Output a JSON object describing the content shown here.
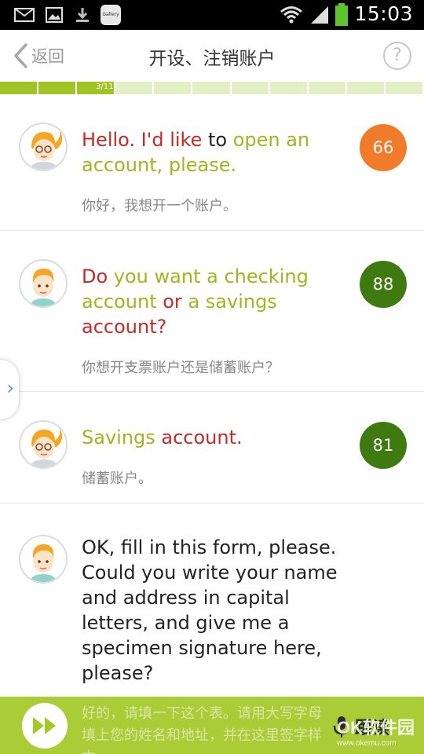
{
  "status_bar": {
    "time": "15:03",
    "icons": [
      "mail-icon",
      "image-icon",
      "download-icon",
      "gallery-app-icon",
      "wifi-icon",
      "signal-icon",
      "battery-icon"
    ],
    "gallery_label": "Gallery"
  },
  "header": {
    "back_label": "返回",
    "title": "开设、注销账户",
    "help_label": "?"
  },
  "progress": {
    "label": "3/11",
    "current": 3,
    "total": 11
  },
  "dialog": [
    {
      "speaker": "woman",
      "words": [
        {
          "t": "Hello. I'd ",
          "c": "red"
        },
        {
          "t": "like ",
          "c": "red"
        },
        {
          "t": "to ",
          "c": "black"
        },
        {
          "t": "open an account, please.",
          "c": "green"
        }
      ],
      "translation": "你好，我想开一个账户。",
      "score": "66",
      "score_color": "#f07b2b"
    },
    {
      "speaker": "man",
      "words": [
        {
          "t": "Do ",
          "c": "red"
        },
        {
          "t": "you want a checking account ",
          "c": "green"
        },
        {
          "t": "or ",
          "c": "red"
        },
        {
          "t": "a savings ",
          "c": "green"
        },
        {
          "t": "account?",
          "c": "red"
        }
      ],
      "translation": "你想开支票账户还是储蓄账户？",
      "score": "88",
      "score_color": "#3f7a10"
    },
    {
      "speaker": "woman",
      "words": [
        {
          "t": "Savings ",
          "c": "green"
        },
        {
          "t": "account.",
          "c": "red"
        }
      ],
      "translation": "储蓄账户。",
      "score": "81",
      "score_color": "#3f7a10"
    },
    {
      "speaker": "man",
      "words": [
        {
          "t": "OK, fill in this form, please. Could you write your name and address in capital letters, and give me a specimen signature here, please?",
          "c": "dark"
        }
      ],
      "translation": "好的，请填一下这个表。请用大写字母填上您的姓名和地址，并在这里签字样本。",
      "score": "",
      "score_color": ""
    }
  ],
  "bottom_bar": {
    "record_label": "跟读",
    "watermark": "OK软件园",
    "watermark_url": "www.okemu.com"
  },
  "colors": {
    "accent_green": "#a4c828",
    "red_word": "#c62a26",
    "green_word": "#9fb61f"
  }
}
